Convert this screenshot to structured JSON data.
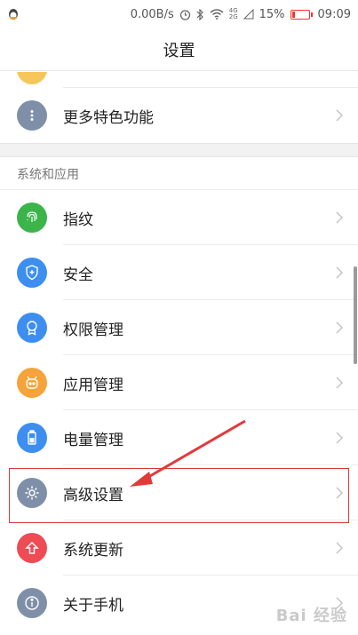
{
  "status_bar": {
    "net_speed": "0.00B/s",
    "lte_top": "4G",
    "lte_bottom": "2G",
    "battery_percent": "15%",
    "battery_level": 0.15,
    "time": "09:09"
  },
  "title": "设置",
  "rows_top": [
    {
      "label": "更多特色功能",
      "icon": "more-dots-icon",
      "color": "#7f8fa8"
    }
  ],
  "section": {
    "header": "系统和应用",
    "items": [
      {
        "label": "指纹",
        "icon": "fingerprint-icon",
        "color": "#3bb54a"
      },
      {
        "label": "安全",
        "icon": "shield-icon",
        "color": "#3d8ef0"
      },
      {
        "label": "权限管理",
        "icon": "badge-icon",
        "color": "#3d8ef0"
      },
      {
        "label": "应用管理",
        "icon": "robot-icon",
        "color": "#f5a33a"
      },
      {
        "label": "电量管理",
        "icon": "battery-icon",
        "color": "#3d8ef0"
      },
      {
        "label": "高级设置",
        "icon": "gear-icon",
        "color": "#7f8fa8"
      },
      {
        "label": "系统更新",
        "icon": "upload-arrow-icon",
        "color": "#ee4b55"
      },
      {
        "label": "关于手机",
        "icon": "info-icon",
        "color": "#7f8fa8"
      }
    ]
  },
  "watermark": "Bai 经验"
}
